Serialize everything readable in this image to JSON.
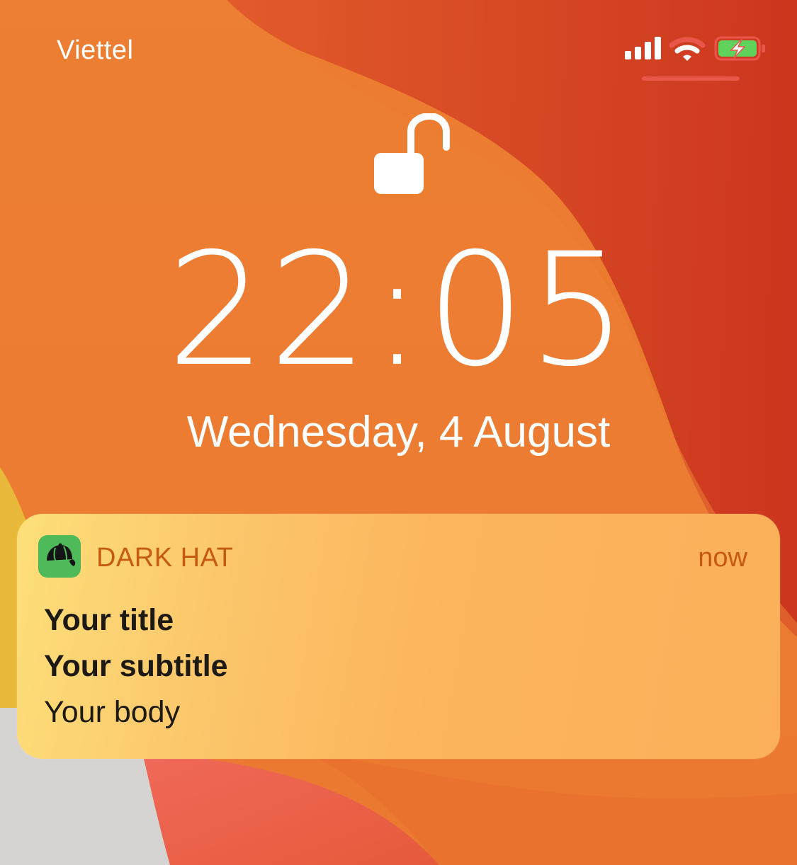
{
  "status_bar": {
    "carrier": "Viettel",
    "signal_icon": "cellular-signal-icon",
    "wifi_icon": "wifi-icon",
    "battery_icon": "battery-charging-icon",
    "battery_color": "#5fd35b"
  },
  "lock_screen": {
    "lock_icon": "unlocked-padlock-icon",
    "time": "22:05",
    "date": "Wednesday, 4 August"
  },
  "notification": {
    "app_icon": "baseball-cap-icon",
    "app_icon_color": "#4fba5a",
    "app_name": "DARK HAT",
    "time": "now",
    "title": "Your title",
    "subtitle": "Your subtitle",
    "body": "Your body"
  },
  "colors": {
    "wallpaper_orange": "#e9782d",
    "wallpaper_red": "#c92a1c",
    "notification_accent": "#c75a12"
  }
}
